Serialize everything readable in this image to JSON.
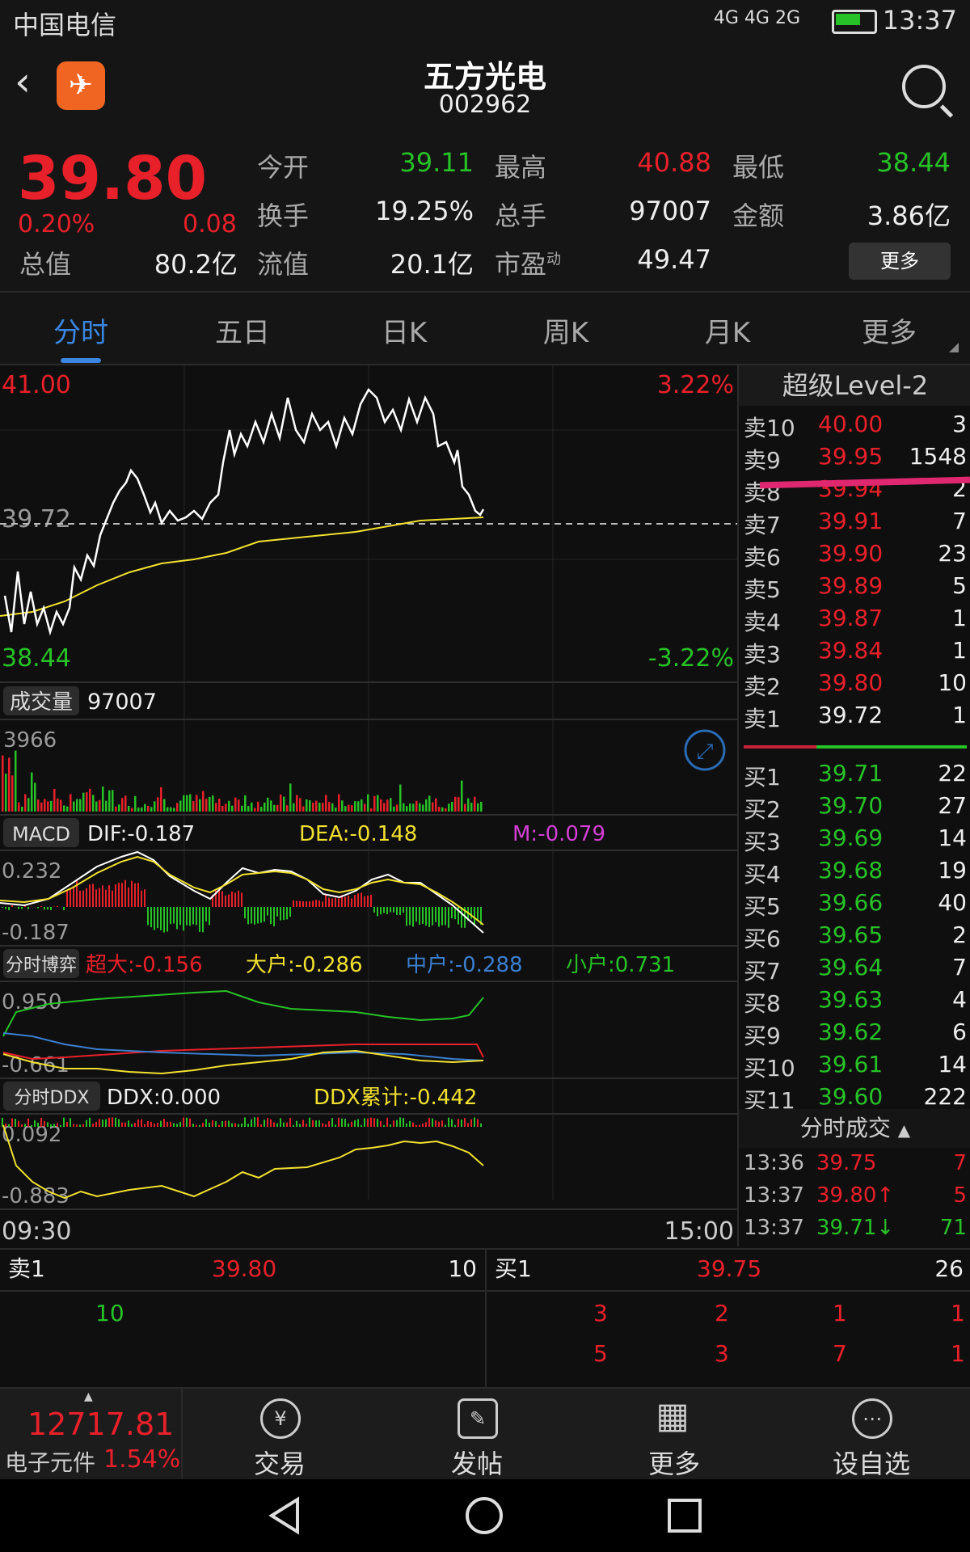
{
  "status_bar": {
    "carrier": "中国电信",
    "network": "4G 4G 2G",
    "time": "13:37"
  },
  "header": {
    "name": "五方光电",
    "code": "002962"
  },
  "quote": {
    "price": "39.80",
    "pct": "0.20%",
    "change": "0.08",
    "rows": [
      [
        {
          "label": "今开",
          "value": "39.11",
          "color": "green"
        },
        {
          "label": "最高",
          "value": "40.88",
          "color": "red"
        },
        {
          "label": "最低",
          "value": "38.44",
          "color": "green"
        }
      ],
      [
        {
          "label": "换手",
          "value": "19.25%",
          "color": "white"
        },
        {
          "label": "总手",
          "value": "97007",
          "color": "white"
        },
        {
          "label": "金额",
          "value": "3.86亿",
          "color": "white"
        }
      ],
      [
        {
          "label": "流值",
          "value": "20.1亿",
          "color": "white"
        },
        {
          "label": "市盈",
          "value": "49.47",
          "color": "white"
        }
      ]
    ],
    "total_label": "总值",
    "total_value": "80.2亿",
    "pe_superscript": "动",
    "more_label": "更多"
  },
  "tabs": [
    "分时",
    "五日",
    "日K",
    "周K",
    "月K",
    "更多"
  ],
  "chart": {
    "price_top": "41.00",
    "price_mid": "39.72",
    "price_bottom": "38.44",
    "pct_top": "3.22%",
    "pct_bottom": "-3.22%",
    "volume_label": "成交量",
    "volume_value": "97007",
    "volume_max": "3966",
    "macd_label": "MACD",
    "dif": "DIF:-0.187",
    "dea": "DEA:-0.148",
    "m": "M:-0.079",
    "macd_top": "0.232",
    "macd_bottom": "-0.187",
    "fsbp_label": "分时博弈",
    "super": "超大:-0.156",
    "big": "大户:-0.286",
    "mid": "中户:-0.288",
    "small": "小户:0.731",
    "fsbp_top": "0.950",
    "fsbp_bottom": "-0.661",
    "ddx_label": "分时DDX",
    "ddx": "DDX:0.000",
    "ddx_sum": "DDX累计:-0.442",
    "ddx_top": "0.092",
    "ddx_bottom": "-0.883",
    "time_start": "09:30",
    "time_end": "15:00"
  },
  "orderbook": {
    "title": "超级Level-2",
    "sells": [
      {
        "label": "卖10",
        "price": "40.00",
        "vol": "3"
      },
      {
        "label": "卖9",
        "price": "39.95",
        "vol": "1548"
      },
      {
        "label": "卖8",
        "price": "39.94",
        "vol": "2"
      },
      {
        "label": "卖7",
        "price": "39.91",
        "vol": "7"
      },
      {
        "label": "卖6",
        "price": "39.90",
        "vol": "23"
      },
      {
        "label": "卖5",
        "price": "39.89",
        "vol": "5"
      },
      {
        "label": "卖4",
        "price": "39.87",
        "vol": "1"
      },
      {
        "label": "卖3",
        "price": "39.84",
        "vol": "1"
      },
      {
        "label": "卖2",
        "price": "39.80",
        "vol": "10"
      },
      {
        "label": "卖1",
        "price": "39.72",
        "vol": "1"
      }
    ],
    "buys": [
      {
        "label": "买1",
        "price": "39.71",
        "vol": "22"
      },
      {
        "label": "买2",
        "price": "39.70",
        "vol": "27"
      },
      {
        "label": "买3",
        "price": "39.69",
        "vol": "14"
      },
      {
        "label": "买4",
        "price": "39.68",
        "vol": "19"
      },
      {
        "label": "买5",
        "price": "39.66",
        "vol": "40"
      },
      {
        "label": "买6",
        "price": "39.65",
        "vol": "2"
      },
      {
        "label": "买7",
        "price": "39.64",
        "vol": "7"
      },
      {
        "label": "买8",
        "price": "39.63",
        "vol": "4"
      },
      {
        "label": "买9",
        "price": "39.62",
        "vol": "6"
      },
      {
        "label": "买10",
        "price": "39.61",
        "vol": "14"
      },
      {
        "label": "买11",
        "price": "39.60",
        "vol": "222"
      }
    ],
    "ticks_title": "分时成交",
    "ticks": [
      {
        "time": "13:36",
        "price": "39.75",
        "vol": "7",
        "color": "red",
        "vcolor": "red"
      },
      {
        "time": "13:37",
        "price": "39.80↑",
        "vol": "5",
        "color": "red",
        "vcolor": "red"
      },
      {
        "time": "13:37",
        "price": "39.71↓",
        "vol": "71",
        "color": "green",
        "vcolor": "green"
      }
    ]
  },
  "queue": {
    "sell_label": "卖1",
    "sell_price": "39.80",
    "sell_vol": "10",
    "buy_label": "买1",
    "buy_price": "39.75",
    "buy_vol": "26",
    "sell_items": [
      "10"
    ],
    "buy_items": [
      "3",
      "2",
      "1",
      "1",
      "5",
      "3",
      "7",
      "1"
    ]
  },
  "nav": {
    "index_value": "12717.81",
    "index_name": "电子元件",
    "index_pct": "1.54%",
    "items": [
      "交易",
      "发帖",
      "更多",
      "设自选"
    ]
  }
}
